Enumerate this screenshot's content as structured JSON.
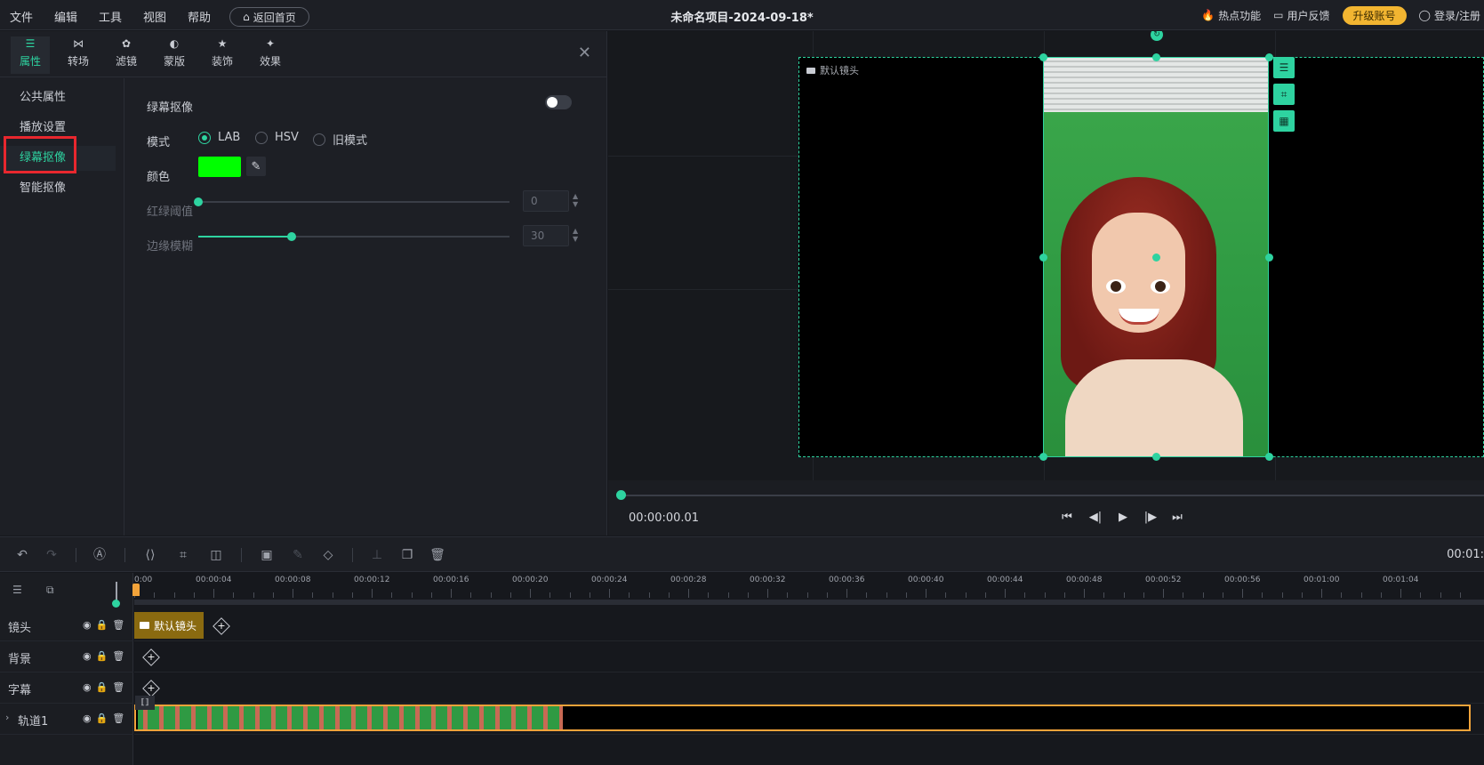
{
  "menu": [
    "文件",
    "编辑",
    "工具",
    "视图",
    "帮助"
  ],
  "home_button": "返回首页",
  "project_title": "未命名项目-2024-09-18*",
  "top_right": {
    "hot": "热点功能",
    "feedback": "用户反馈",
    "upgrade": "升级账号",
    "login": "登录/注册"
  },
  "tool_tabs": [
    {
      "label": "属性",
      "icon": "sliders-icon",
      "active": true
    },
    {
      "label": "转场",
      "icon": "transition-icon"
    },
    {
      "label": "滤镜",
      "icon": "filter-icon"
    },
    {
      "label": "蒙版",
      "icon": "mask-icon"
    },
    {
      "label": "装饰",
      "icon": "decoration-icon"
    },
    {
      "label": "效果",
      "icon": "effect-icon"
    }
  ],
  "side_nav": [
    {
      "label": "公共属性"
    },
    {
      "label": "播放设置"
    },
    {
      "label": "绿幕抠像",
      "active": true
    },
    {
      "label": "智能抠像"
    }
  ],
  "chroma": {
    "title": "绿幕抠像",
    "enabled": false,
    "mode_label": "模式",
    "modes": [
      "LAB",
      "HSV",
      "旧模式"
    ],
    "selected_mode": "LAB",
    "color_label": "颜色",
    "color_value": "#00ff00",
    "threshold_label": "红绿阈值",
    "threshold_value": "0",
    "threshold_fraction": 0,
    "blur_label": "边缘模糊",
    "blur_value": "30",
    "blur_fraction": 0.3
  },
  "preview": {
    "camera_label": "默认镜头",
    "timecode": "00:00:00.01",
    "progress_fraction": 0
  },
  "toolbar": {
    "duration": "00:01:"
  },
  "timeline": {
    "ticks": [
      "0:00",
      "00:00:04",
      "00:00:08",
      "00:00:12",
      "00:00:16",
      "00:00:20",
      "00:00:24",
      "00:00:28",
      "00:00:32",
      "00:00:36",
      "00:00:40",
      "00:00:44",
      "00:00:48",
      "00:00:52",
      "00:00:56",
      "00:01:00",
      "00:01:04"
    ],
    "tracks": [
      "镜头",
      "背景",
      "字幕",
      "轨道1"
    ],
    "camera_clip": "默认镜头"
  },
  "colors": {
    "accent": "#2ed3a0",
    "upgrade": "#f2b531",
    "highlight": "#e8272e",
    "clip_border": "#f2a33a"
  }
}
